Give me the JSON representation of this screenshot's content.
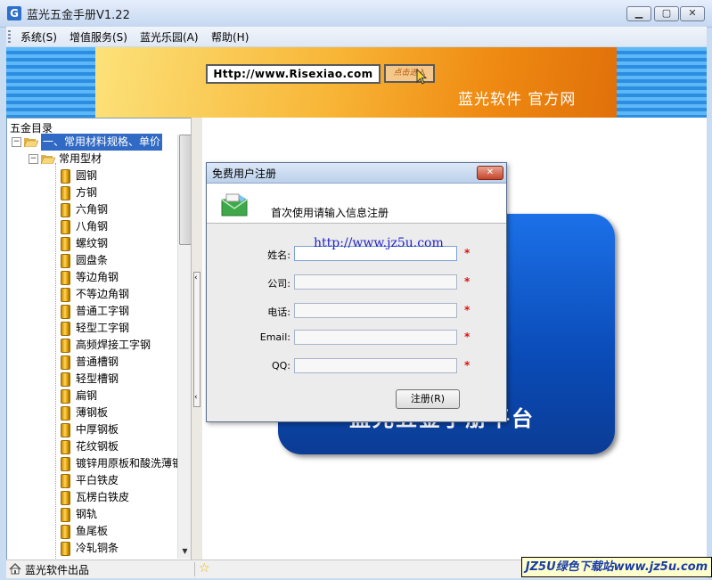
{
  "window": {
    "title": "蓝光五金手册V1.22"
  },
  "menu": [
    "系统(S)",
    "增值服务(S)",
    "蓝光乐园(A)",
    "帮助(H)"
  ],
  "banner": {
    "url_text": "Http://www.Risexiao.com",
    "go_button": "点击进入",
    "slogan": "蓝光软件  官方网"
  },
  "tree": {
    "header": "五金目录",
    "top_item": "一、常用材料规格、单价",
    "group": "常用型材",
    "items": [
      "圆钢",
      "方钢",
      "六角钢",
      "八角钢",
      "螺纹钢",
      "圆盘条",
      "等边角钢",
      "不等边角钢",
      "普通工字钢",
      "轻型工字钢",
      "高频焊接工字钢",
      "普通槽钢",
      "轻型槽钢",
      "扁钢",
      "薄钢板",
      "中厚钢板",
      "花纹钢板",
      "镀锌用原板和酸洗薄钢",
      "平白铁皮",
      "瓦楞白铁皮",
      "钢轨",
      "鱼尾板",
      "冷轧铜条"
    ]
  },
  "content": {
    "card_text": "蓝光五金手册平台"
  },
  "dialog": {
    "title": "免费用户注册",
    "intro": "首次使用请输入信息注册",
    "fields": [
      {
        "label": "姓名:",
        "value": ""
      },
      {
        "label": "公司:",
        "value": ""
      },
      {
        "label": "电话:",
        "value": ""
      },
      {
        "label": "Email:",
        "value": ""
      },
      {
        "label": "QQ:",
        "value": ""
      }
    ],
    "required_mark": "*",
    "submit": "注册(R)",
    "watermark": "http://www.jz5u.com"
  },
  "status": {
    "text": "蓝光软件出品",
    "badge": "JZ5U绿色下载站www.jz5u.com"
  },
  "colors": {
    "accent": "#316ac5",
    "banner_orange": "#f39a1c",
    "card_blue": "#0a4bb7",
    "required": "#dd1111"
  }
}
